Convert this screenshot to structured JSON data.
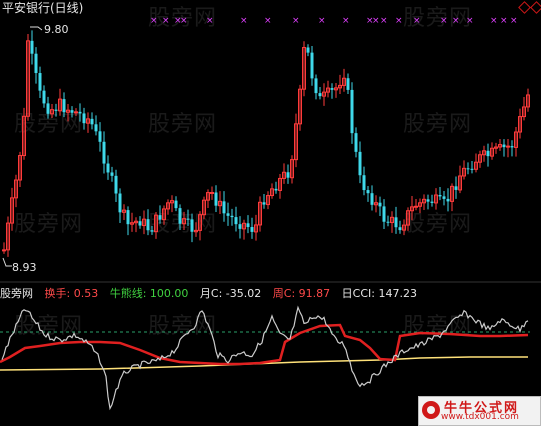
{
  "title": "平安银行(日线)",
  "price_high_label": "9.80",
  "price_low_label": "8.93",
  "watermark_text": "股旁网",
  "indicator_bar": {
    "name": "股旁网",
    "items": [
      {
        "label": "换手",
        "value": "0.53",
        "label_color": "#ff4a4a",
        "value_color": "#ff4a4a"
      },
      {
        "label": "牛熊线",
        "value": "100.00",
        "label_color": "#40d040",
        "value_color": "#40d040"
      },
      {
        "label": "月C",
        "value": "-35.02",
        "label_color": "#e6e6e6",
        "value_color": "#e6e6e6"
      },
      {
        "label": "周C",
        "value": "91.87",
        "label_color": "#ff4a4a",
        "value_color": "#ff4a4a"
      },
      {
        "label": "日CCI",
        "value": "147.23",
        "label_color": "#e6e6e6",
        "value_color": "#e6e6e6"
      }
    ]
  },
  "logo": {
    "main": "牛牛公式网",
    "url": "www.tdx001.com"
  },
  "colors": {
    "up": "#ff3b3b",
    "down": "#3fd9ea",
    "marker": "#e040ff",
    "bull_line": "#ffe27a",
    "week_line": "#e02020",
    "cci_line": "#cccccc",
    "dash_line": "#2aa06a"
  }
}
